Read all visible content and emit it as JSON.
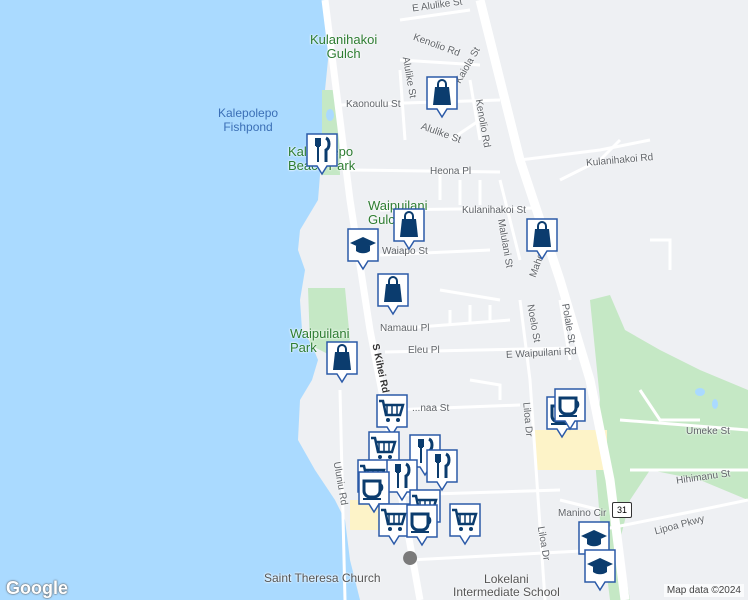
{
  "labels": {
    "water": [
      {
        "name": "kalepolepo-fishpond-label",
        "text": "Kalepolepo\nFishpond"
      }
    ],
    "green": [
      {
        "name": "kulanihakoi-gulch-label",
        "text": "Kulanihakoi\nGulch"
      },
      {
        "name": "kalepolepo-beach-park-label",
        "text": "Kalepolepo\nBeach Park"
      },
      {
        "name": "waipuilani-gulch-label",
        "text": "Waipuilani\nGulch"
      },
      {
        "name": "waipuilani-park-label",
        "text": "Waipuilani\nPark"
      }
    ],
    "streets": [
      {
        "name": "street-e-alulike-st",
        "text": "E Alulike St"
      },
      {
        "name": "street-kenolio-rd-north",
        "text": "Kenolio Rd"
      },
      {
        "name": "street-kaiola-st",
        "text": "Kaiola St"
      },
      {
        "name": "street-alulike-st",
        "text": "Alulike St"
      },
      {
        "name": "street-kaonoulu-st",
        "text": "Kaonoulu St"
      },
      {
        "name": "street-kenolio-rd",
        "text": "Kenolio Rd"
      },
      {
        "name": "street-alulike-st-2",
        "text": "Alulike St"
      },
      {
        "name": "street-kulanihakoi-rd",
        "text": "Kulanihakoi Rd"
      },
      {
        "name": "street-heona-pl",
        "text": "Heona Pl"
      },
      {
        "name": "street-kulanihakoi-st",
        "text": "Kulanihakoi St"
      },
      {
        "name": "street-malulani-st",
        "text": "Malulani St"
      },
      {
        "name": "street-mahealani",
        "text": "Mahe..."
      },
      {
        "name": "street-waiapo-st",
        "text": "Waiapo St"
      },
      {
        "name": "street-namauu-pl",
        "text": "Namauu Pl"
      },
      {
        "name": "street-polale-st",
        "text": "Polale St"
      },
      {
        "name": "street-noelo-st",
        "text": "Noelo St"
      },
      {
        "name": "street-eleu-pl",
        "text": "Eleu Pl"
      },
      {
        "name": "street-e-waipuilani-rd",
        "text": "E Waipuilani Rd"
      },
      {
        "name": "street-s-kihei-rd",
        "text": "S Kihei Rd"
      },
      {
        "name": "street-haunaa-st",
        "text": "...naa St"
      },
      {
        "name": "street-liloa-dr",
        "text": "Liloa Dr"
      },
      {
        "name": "street-umeke-st",
        "text": "Umeke St"
      },
      {
        "name": "street-hihimanu-st",
        "text": "Hihimanu St"
      },
      {
        "name": "street-uluniu-rd",
        "text": "Uluniu Rd"
      },
      {
        "name": "street-manino-cir",
        "text": "Manino Cir"
      },
      {
        "name": "street-liloa-dr-2",
        "text": "Liloa Dr"
      },
      {
        "name": "street-lipoa-pkwy",
        "text": "Lipoa Pkwy"
      }
    ],
    "pois": [
      {
        "name": "saint-theresa-church-label",
        "text": "Saint Theresa Church"
      },
      {
        "name": "lokelani-intermediate-school-label",
        "text": "Lokelani\nIntermediate School"
      }
    ]
  },
  "route_shield": "31",
  "attribution": "Map data ©2024",
  "google_logo": "Google",
  "markers": [
    {
      "name": "restaurant-marker",
      "icon": "restaurant-icon"
    },
    {
      "name": "shopping-marker",
      "icon": "shopping-bag-icon"
    },
    {
      "name": "shopping-marker",
      "icon": "shopping-bag-icon"
    },
    {
      "name": "shopping-marker",
      "icon": "shopping-bag-icon"
    },
    {
      "name": "school-marker",
      "icon": "graduation-cap-icon"
    },
    {
      "name": "shopping-marker",
      "icon": "shopping-bag-icon"
    },
    {
      "name": "shopping-marker",
      "icon": "shopping-bag-icon"
    },
    {
      "name": "cafe-marker",
      "icon": "coffee-cup-icon"
    },
    {
      "name": "cafe-marker",
      "icon": "coffee-cup-icon"
    },
    {
      "name": "grocery-marker",
      "icon": "shopping-cart-icon"
    },
    {
      "name": "grocery-marker",
      "icon": "shopping-cart-icon"
    },
    {
      "name": "restaurant-marker",
      "icon": "restaurant-icon"
    },
    {
      "name": "grocery-marker",
      "icon": "shopping-cart-icon"
    },
    {
      "name": "restaurant-marker",
      "icon": "restaurant-icon"
    },
    {
      "name": "restaurant-marker",
      "icon": "restaurant-icon"
    },
    {
      "name": "cafe-marker",
      "icon": "coffee-cup-icon"
    },
    {
      "name": "grocery-marker",
      "icon": "shopping-cart-icon"
    },
    {
      "name": "grocery-marker",
      "icon": "shopping-cart-icon"
    },
    {
      "name": "cafe-marker",
      "icon": "coffee-cup-icon"
    },
    {
      "name": "grocery-marker",
      "icon": "shopping-cart-icon"
    },
    {
      "name": "school-marker",
      "icon": "graduation-cap-icon"
    },
    {
      "name": "school-marker",
      "icon": "graduation-cap-icon"
    }
  ],
  "colors": {
    "ocean": "#aadaff",
    "land": "#eef0f3",
    "park": "#c5e8c5",
    "sand": "#fdf3c8",
    "marker_border": "#2b5aa8",
    "marker_icon": "#0b3c6e"
  }
}
